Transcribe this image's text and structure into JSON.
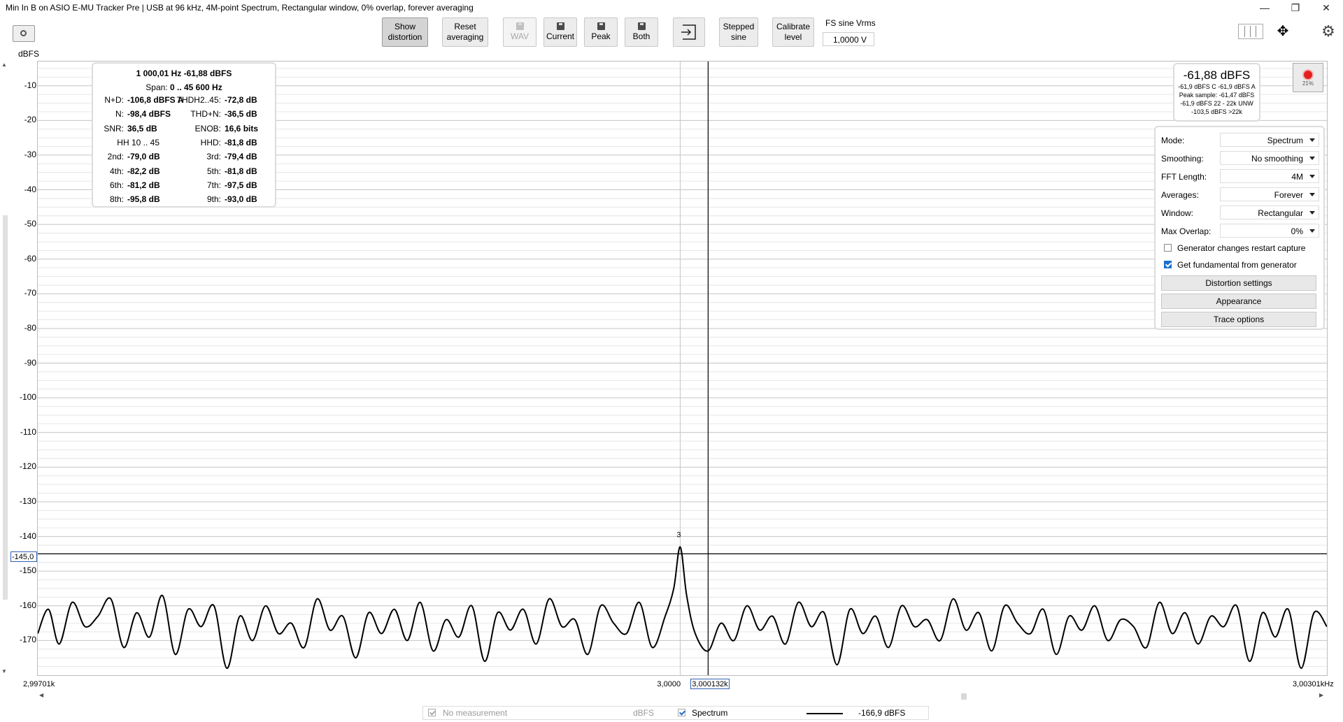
{
  "window": {
    "title": "Min In B on ASIO E-MU Tracker Pre | USB at 96 kHz, 4M-point Spectrum, Rectangular window, 0% overlap, forever averaging",
    "min_glyph": "—",
    "max_glyph": "❐",
    "close_glyph": "✕"
  },
  "toolbar": {
    "show_distortion": [
      "Show",
      "distortion"
    ],
    "reset_averaging": [
      "Reset",
      "averaging"
    ],
    "wav": "WAV",
    "current": "Current",
    "peak": "Peak",
    "both": "Both",
    "stepped_sine": [
      "Stepped",
      "sine"
    ],
    "calibrate_level": [
      "Calibrate",
      "level"
    ],
    "fs_label": "FS sine Vrms",
    "fs_value": "1,0000 V"
  },
  "plot": {
    "ylabel": "dBFS",
    "cursor_y_value": "-145,0",
    "cursor_x_value": "3,000132k",
    "marker_label": "3"
  },
  "readout": {
    "header1": "1 000,01 Hz  -61,88 dBFS",
    "header2_label": "Span:",
    "header2_value": "0 .. 45 600 Hz",
    "rows": [
      {
        "l1": "N+D:",
        "v1": "-106,8 dBFS A",
        "l2": "THDH2..45:",
        "v2": "-72,8 dB"
      },
      {
        "l1": "N:",
        "v1": "-98,4 dBFS",
        "l2": "THD+N:",
        "v2": "-36,5 dB"
      },
      {
        "l1": "SNR:",
        "v1": "36,5 dB",
        "l2": "ENOB:",
        "v2": "16,6 bits"
      },
      {
        "l1": "HH 10 .. 45",
        "v1": "",
        "l2": "HHD:",
        "v2": "-81,8 dB"
      },
      {
        "l1": "2nd:",
        "v1": "-79,0 dB",
        "l2": "3rd:",
        "v2": "-79,4 dB"
      },
      {
        "l1": "4th:",
        "v1": "-82,2 dB",
        "l2": "5th:",
        "v2": "-81,8 dB"
      },
      {
        "l1": "6th:",
        "v1": "-81,2 dB",
        "l2": "7th:",
        "v2": "-97,5 dB"
      },
      {
        "l1": "8th:",
        "v1": "-95,8 dB",
        "l2": "9th:",
        "v2": "-93,0 dB"
      }
    ]
  },
  "level": {
    "main": "-61,88 dBFS",
    "line1": "-61,9 dBFS C  -61,9 dBFS A",
    "line2": "Peak sample: -61,47 dBFS",
    "line3": "-61,9 dBFS 22 - 22k UNW",
    "line4": "-103,5 dBFS >22k",
    "rec_pct": "21%"
  },
  "settings": {
    "rows": [
      {
        "label": "Mode:",
        "value": "Spectrum"
      },
      {
        "label": "Smoothing:",
        "value": "No smoothing"
      },
      {
        "label": "FFT Length:",
        "value": "4M"
      },
      {
        "label": "Averages:",
        "value": "Forever"
      },
      {
        "label": "Window:",
        "value": "Rectangular"
      },
      {
        "label": "Max Overlap:",
        "value": "0%"
      }
    ],
    "checks": [
      {
        "label": "Generator changes restart capture",
        "checked": false
      },
      {
        "label": "Get fundamental from generator",
        "checked": true
      }
    ],
    "buttons": [
      "Distortion settings",
      "Appearance",
      "Trace options"
    ]
  },
  "legend": {
    "no_measurement": "No measurement",
    "unit": "dBFS",
    "spectrum": "Spectrum",
    "value": "-166,9 dBFS"
  },
  "chart_data": {
    "type": "line",
    "xlabel": "",
    "ylabel": "dBFS",
    "x_tick_labels": [
      "2,99701k",
      "3,0000",
      "3,00301kHz"
    ],
    "xlim": [
      2997.01,
      3003.01
    ],
    "ylim": [
      -180,
      -3
    ],
    "y_ticks": [
      -10,
      -20,
      -30,
      -40,
      -50,
      -60,
      -70,
      -80,
      -90,
      -100,
      -110,
      -120,
      -130,
      -140,
      -150,
      -160,
      -170
    ],
    "grid": true,
    "peak": {
      "x": 3000.0,
      "y": -143
    },
    "series": [
      {
        "x": [
          2997.01,
          2997.06,
          2997.11,
          2997.17,
          2997.23,
          2997.29,
          2997.35,
          2997.41,
          2997.47,
          2997.53,
          2997.59,
          2997.65,
          2997.71,
          2997.77,
          2997.83,
          2997.89,
          2997.95,
          2998.01,
          2998.07,
          2998.13,
          2998.19,
          2998.25,
          2998.31,
          2998.37,
          2998.43,
          2998.49,
          2998.55,
          2998.61,
          2998.67,
          2998.73,
          2998.79,
          2998.85,
          2998.91,
          2998.97,
          2999.03,
          2999.09,
          2999.15,
          2999.21,
          2999.27,
          2999.33,
          2999.39,
          2999.45,
          2999.51,
          2999.57,
          2999.63,
          2999.69,
          2999.75,
          2999.81,
          2999.87,
          2999.93,
          2999.97,
          3000.0,
          3000.03,
          3000.07,
          3000.13,
          3000.19,
          3000.25,
          3000.31,
          3000.37,
          3000.43,
          3000.49,
          3000.55,
          3000.61,
          3000.67,
          3000.73,
          3000.79,
          3000.85,
          3000.91,
          3000.97,
          3001.03,
          3001.09,
          3001.15,
          3001.21,
          3001.27,
          3001.33,
          3001.39,
          3001.45,
          3001.51,
          3001.57,
          3001.63,
          3001.69,
          3001.75,
          3001.81,
          3001.87,
          3001.93,
          3001.99,
          3002.05,
          3002.11,
          3002.17,
          3002.23,
          3002.29,
          3002.35,
          3002.41,
          3002.47,
          3002.53,
          3002.59,
          3002.65,
          3002.71,
          3002.77,
          3002.83,
          3002.89,
          3002.95,
          3003.01
        ],
        "y": [
          -168,
          -161,
          -171,
          -159,
          -166,
          -163,
          -158,
          -172,
          -162,
          -169,
          -157,
          -174,
          -161,
          -166,
          -160,
          -178,
          -163,
          -170,
          -160,
          -168,
          -165,
          -172,
          -158,
          -167,
          -163,
          -175,
          -162,
          -168,
          -161,
          -170,
          -159,
          -173,
          -164,
          -169,
          -160,
          -176,
          -162,
          -167,
          -161,
          -171,
          -158,
          -166,
          -164,
          -174,
          -160,
          -165,
          -168,
          -159,
          -172,
          -163,
          -155,
          -143,
          -157,
          -168,
          -173,
          -165,
          -170,
          -160,
          -167,
          -163,
          -171,
          -159,
          -166,
          -162,
          -177,
          -161,
          -168,
          -163,
          -172,
          -160,
          -166,
          -164,
          -170,
          -158,
          -167,
          -162,
          -173,
          -160,
          -165,
          -168,
          -161,
          -174,
          -163,
          -167,
          -160,
          -170,
          -164,
          -166,
          -172,
          -159,
          -168,
          -162,
          -171,
          -163,
          -166,
          -160,
          -176,
          -162,
          -169,
          -161,
          -178,
          -162,
          -166
        ]
      }
    ]
  }
}
